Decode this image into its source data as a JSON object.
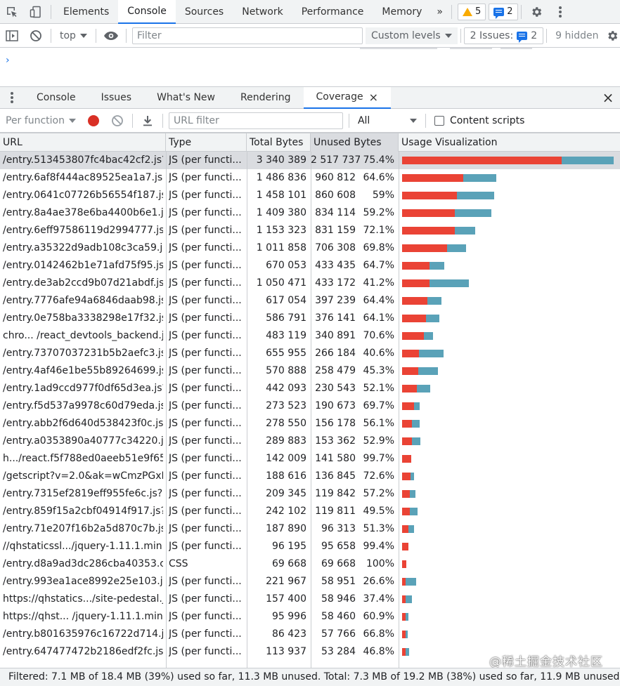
{
  "main_tabs": {
    "items": [
      "Elements",
      "Console",
      "Sources",
      "Network",
      "Performance",
      "Memory"
    ],
    "active": "Console",
    "more": "»",
    "warnings_count": "5",
    "messages_count": "2"
  },
  "console_toolbar": {
    "context": "top",
    "filter_placeholder": "Filter",
    "levels": "Custom levels",
    "issues_label": "2 Issues:",
    "issues_count": "2",
    "hidden": "9 hidden"
  },
  "console_output": {
    "prompt": "›"
  },
  "drawer": {
    "tabs": [
      "Console",
      "Issues",
      "What's New",
      "Rendering",
      "Coverage"
    ],
    "active": "Coverage",
    "close_tab": "×",
    "close_drawer": "×"
  },
  "coverage_toolbar": {
    "mode": "Per function",
    "url_filter_placeholder": "URL filter",
    "type_filter": "All",
    "content_scripts": "Content scripts"
  },
  "table": {
    "headers": {
      "url": "URL",
      "type": "Type",
      "total": "Total Bytes",
      "unused": "Unused Bytes",
      "viz": "Usage Visualization"
    },
    "rows": [
      {
        "url": "/entry.513453807fc4bac42cf2.js?p",
        "type": "JS (per functi...",
        "total": "3 340 389",
        "unused": "2 517 737",
        "pct": "75.4%",
        "total_n": 3340389,
        "unused_n": 2517737,
        "selected": true
      },
      {
        "url": "/entry.6af8f444ac89525ea1a7.js?p",
        "type": "JS (per functi...",
        "total": "1 486 836",
        "unused": "960 812",
        "pct": "64.6%",
        "total_n": 1486836,
        "unused_n": 960812
      },
      {
        "url": "/entry.0641c07726b56554f187.js?p",
        "type": "JS (per functi...",
        "total": "1 458 101",
        "unused": "860 608",
        "pct": "59%",
        "total_n": 1458101,
        "unused_n": 860608
      },
      {
        "url": "/entry.8a4ae378e6ba4400b6e1.js?",
        "type": "JS (per functi...",
        "total": "1 409 380",
        "unused": "834 114",
        "pct": "59.2%",
        "total_n": 1409380,
        "unused_n": 834114
      },
      {
        "url": "/entry.6eff97586119d2994777.js?p",
        "type": "JS (per functi...",
        "total": "1 153 323",
        "unused": "831 159",
        "pct": "72.1%",
        "total_n": 1153323,
        "unused_n": 831159
      },
      {
        "url": "/entry.a35322d9adb108c3ca59.js?",
        "type": "JS (per functi...",
        "total": "1 011 858",
        "unused": "706 308",
        "pct": "69.8%",
        "total_n": 1011858,
        "unused_n": 706308
      },
      {
        "url": "/entry.0142462b1e71afd75f95.js?p",
        "type": "JS (per functi...",
        "total": "670 053",
        "unused": "433 435",
        "pct": "64.7%",
        "total_n": 670053,
        "unused_n": 433435
      },
      {
        "url": "/entry.de3ab2ccd9b07d21abdf.js?",
        "type": "JS (per functi...",
        "total": "1 050 471",
        "unused": "433 172",
        "pct": "41.2%",
        "total_n": 1050471,
        "unused_n": 433172
      },
      {
        "url": "/entry.7776afe94a6846daab98.js?p",
        "type": "JS (per functi...",
        "total": "617 054",
        "unused": "397 239",
        "pct": "64.4%",
        "total_n": 617054,
        "unused_n": 397239
      },
      {
        "url": "/entry.0e758ba3338298e17f32.js?p",
        "type": "JS (per functi...",
        "total": "586 791",
        "unused": "376 141",
        "pct": "64.1%",
        "total_n": 586791,
        "unused_n": 376141
      },
      {
        "url": "chro... /react_devtools_backend.js",
        "type": "JS (per functi...",
        "total": "483 119",
        "unused": "340 891",
        "pct": "70.6%",
        "total_n": 483119,
        "unused_n": 340891
      },
      {
        "url": "/entry.73707037231b5b2aefc3.js?p",
        "type": "JS (per functi...",
        "total": "655 955",
        "unused": "266 184",
        "pct": "40.6%",
        "total_n": 655955,
        "unused_n": 266184
      },
      {
        "url": "/entry.4af46e1be55b89264699.js?p",
        "type": "JS (per functi...",
        "total": "570 888",
        "unused": "258 479",
        "pct": "45.3%",
        "total_n": 570888,
        "unused_n": 258479
      },
      {
        "url": "/entry.1ad9ccd977f0df65d3ea.js?p",
        "type": "JS (per functi...",
        "total": "442 093",
        "unused": "230 543",
        "pct": "52.1%",
        "total_n": 442093,
        "unused_n": 230543
      },
      {
        "url": "/entry.f5d537a9978c60d79eda.js?p",
        "type": "JS (per functi...",
        "total": "273 523",
        "unused": "190 673",
        "pct": "69.7%",
        "total_n": 273523,
        "unused_n": 190673
      },
      {
        "url": "/entry.abb2f6d640d538423f0c.js?p",
        "type": "JS (per functi...",
        "total": "278 550",
        "unused": "156 178",
        "pct": "56.1%",
        "total_n": 278550,
        "unused_n": 156178
      },
      {
        "url": "/entry.a0353890a40777c34220.js?p",
        "type": "JS (per functi...",
        "total": "289 883",
        "unused": "153 362",
        "pct": "52.9%",
        "total_n": 289883,
        "unused_n": 153362
      },
      {
        "url": "h.../react.f5f788ed0aeeb51e9f65.js",
        "type": "JS (per functi...",
        "total": "142 009",
        "unused": "141 580",
        "pct": "99.7%",
        "total_n": 142009,
        "unused_n": 141580
      },
      {
        "url": "/getscript?v=2.0&ak=wCmzPGxDf",
        "type": "JS (per functi...",
        "total": "188 616",
        "unused": "136 845",
        "pct": "72.6%",
        "total_n": 188616,
        "unused_n": 136845
      },
      {
        "url": "/entry.7315ef2819eff955fe6c.js?pn",
        "type": "JS (per functi...",
        "total": "209 345",
        "unused": "119 842",
        "pct": "57.2%",
        "total_n": 209345,
        "unused_n": 119842
      },
      {
        "url": "/entry.859f15a2cbf04914f917.js?pr",
        "type": "JS (per functi...",
        "total": "242 102",
        "unused": "119 811",
        "pct": "49.5%",
        "total_n": 242102,
        "unused_n": 119811
      },
      {
        "url": "/entry.71e207f16b2a5d870c7b.js?p",
        "type": "JS (per functi...",
        "total": "187 890",
        "unused": "96 313",
        "pct": "51.3%",
        "total_n": 187890,
        "unused_n": 96313
      },
      {
        "url": "//qhstaticssl.../jquery-1.11.1.min.js",
        "type": "JS (per functi...",
        "total": "96 195",
        "unused": "95 658",
        "pct": "99.4%",
        "total_n": 96195,
        "unused_n": 95658
      },
      {
        "url": "/entry.d8a9ad3dc286cba40353.css",
        "type": "CSS",
        "total": "69 668",
        "unused": "69 668",
        "pct": "100%",
        "total_n": 69668,
        "unused_n": 69668
      },
      {
        "url": "/entry.993ea1ace8992e25e103.js?p",
        "type": "JS (per functi...",
        "total": "221 967",
        "unused": "58 951",
        "pct": "26.6%",
        "total_n": 221967,
        "unused_n": 58951
      },
      {
        "url": "https://qhstatics.../site-pedestal.js",
        "type": "JS (per functi...",
        "total": "157 400",
        "unused": "58 946",
        "pct": "37.4%",
        "total_n": 157400,
        "unused_n": 58946
      },
      {
        "url": "https://qhst... /jquery-1.11.1.min.js",
        "type": "JS (per functi...",
        "total": "95 996",
        "unused": "58 460",
        "pct": "60.9%",
        "total_n": 95996,
        "unused_n": 58460
      },
      {
        "url": "/entry.b801635976c16722d714.js?",
        "type": "JS (per functi...",
        "total": "86 423",
        "unused": "57 766",
        "pct": "66.8%",
        "total_n": 86423,
        "unused_n": 57766
      },
      {
        "url": "/entry.647477472b2186edf2fc.js?p",
        "type": "JS (per functi...",
        "total": "113 937",
        "unused": "53 284",
        "pct": "46.8%",
        "total_n": 113937,
        "unused_n": 53284
      }
    ]
  },
  "status": "Filtered: 7.1 MB of 18.4 MB (39%) used so far, 11.3 MB unused. Total: 7.3 MB of 19.2 MB (38%) used so far, 11.9 MB unused.",
  "watermark": "@稀土掘金技术社区",
  "colors": {
    "used": "#ea4335",
    "unused": "#5aa2b8",
    "accent": "#1a73e8"
  }
}
